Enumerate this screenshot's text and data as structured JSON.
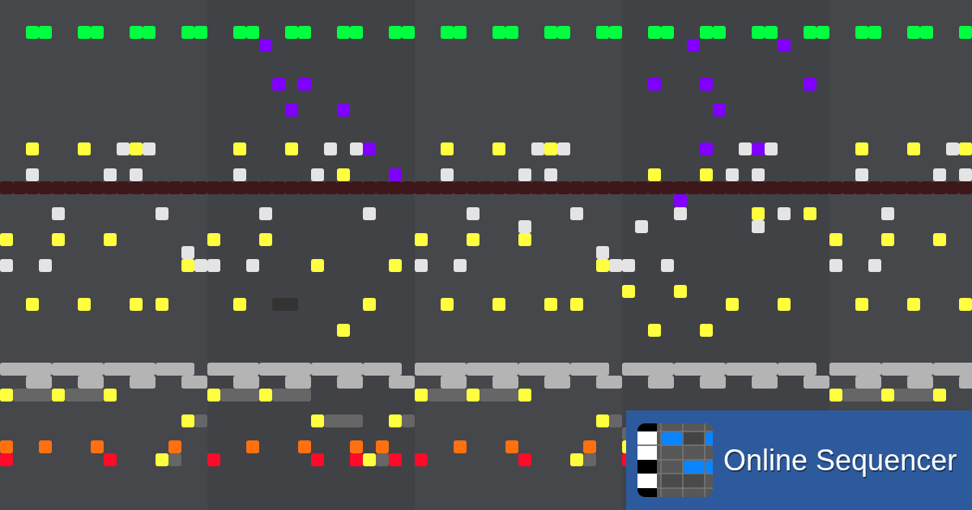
{
  "banner": {
    "title": "Online Sequencer"
  }
}
